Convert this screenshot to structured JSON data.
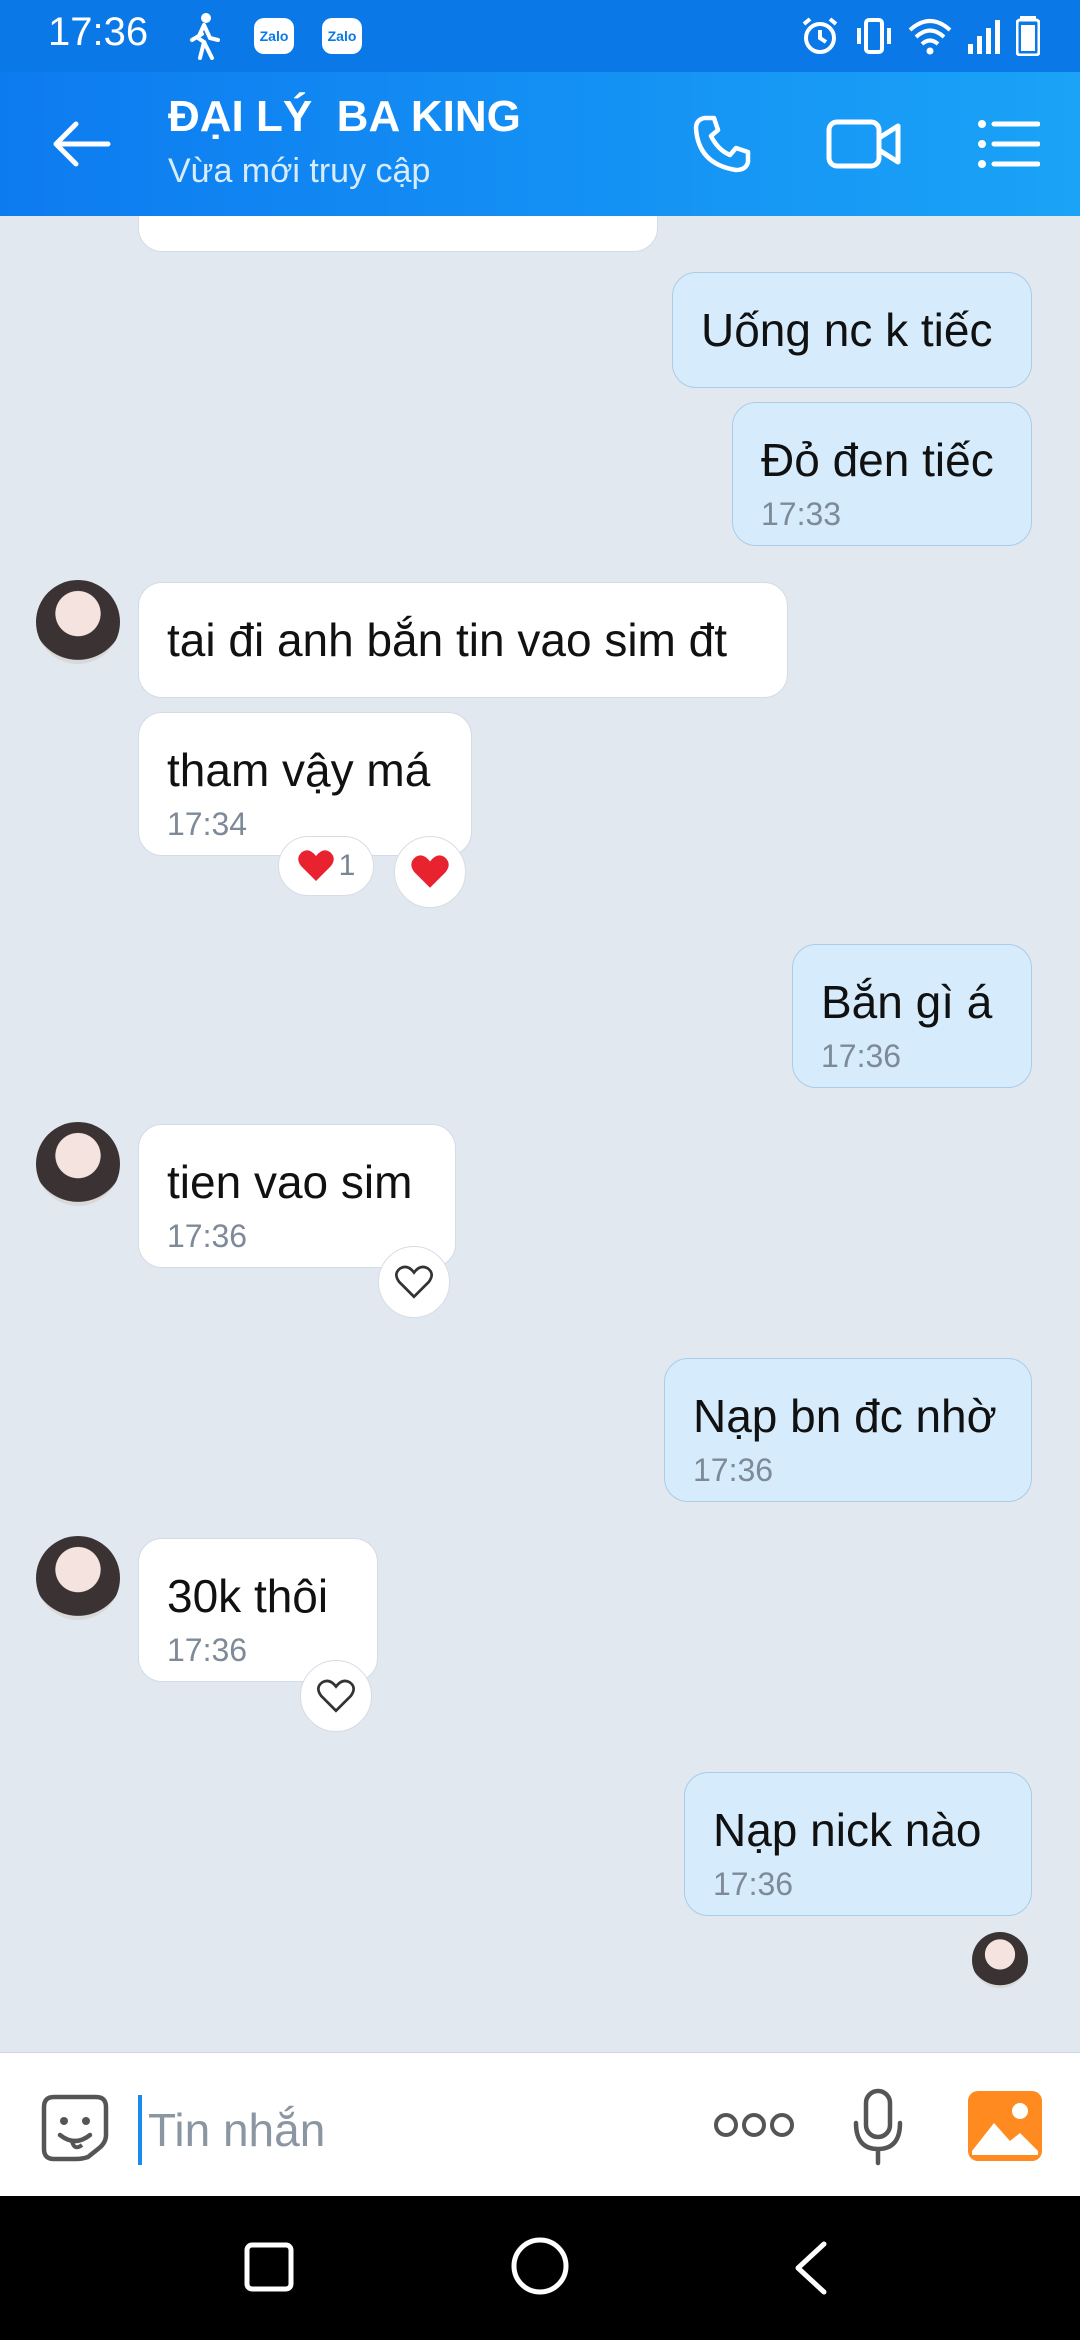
{
  "status_bar": {
    "time": "17:36",
    "zalo_1": "Zalo",
    "zalo_2": "Zalo"
  },
  "header": {
    "contact_name": "ĐẠI LÝ  BA KING",
    "status": "Vừa mới truy cập"
  },
  "messages": [
    {
      "side": "out",
      "text": "Uống nc k tiếc"
    },
    {
      "side": "out",
      "text": "Đỏ đen tiếc",
      "time": "17:33"
    },
    {
      "side": "in",
      "text": "tai đi anh bắn tin vao sim đt"
    },
    {
      "side": "in",
      "text": "tham vậy má",
      "time": "17:34",
      "reaction_count": "1"
    },
    {
      "side": "out",
      "text": "Bắn gì á",
      "time": "17:36"
    },
    {
      "side": "in",
      "text": "tien vao sim",
      "time": "17:36"
    },
    {
      "side": "out",
      "text": "Nạp bn đc nhờ",
      "time": "17:36"
    },
    {
      "side": "in",
      "text": "30k thôi",
      "time": "17:36"
    },
    {
      "side": "out",
      "text": "Nạp nick nào",
      "time": "17:36"
    }
  ],
  "input": {
    "placeholder": "Tin nhắn"
  },
  "colors": {
    "header": "#0d7bf0",
    "outgoing_bubble": "#d6ecfd",
    "incoming_bubble": "#ffffff",
    "background": "#e2e8f0",
    "reaction_heart": "#e8232f"
  }
}
